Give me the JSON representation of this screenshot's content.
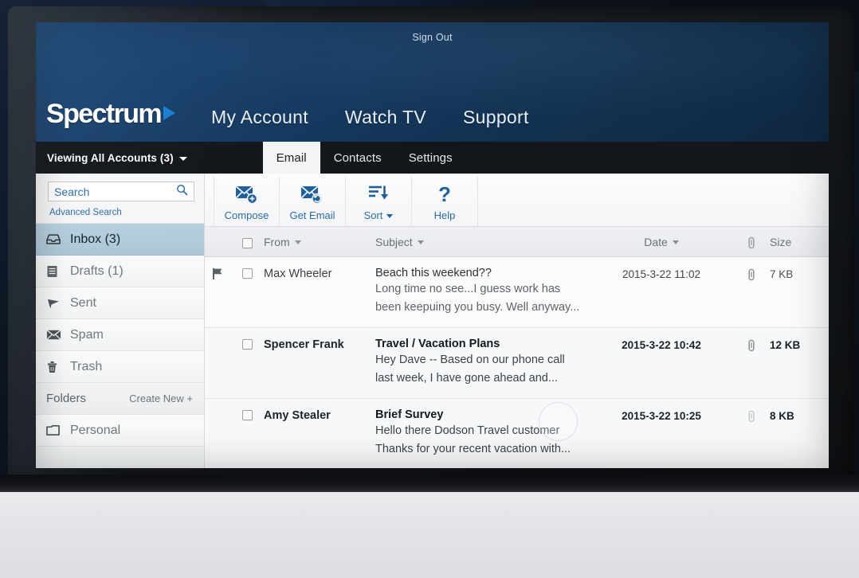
{
  "header": {
    "sign_out": "Sign Out",
    "logo_text": "Spectrum",
    "nav": [
      {
        "label": "My Account"
      },
      {
        "label": "Watch TV"
      },
      {
        "label": "Support"
      }
    ]
  },
  "account_bar": {
    "viewing_label": "Viewing All Accounts (3)",
    "tabs": [
      {
        "label": "Email",
        "active": true
      },
      {
        "label": "Contacts",
        "active": false
      },
      {
        "label": "Settings",
        "active": false
      }
    ]
  },
  "sidebar": {
    "search": {
      "value": "",
      "placeholder": "Search"
    },
    "advanced_search": "Advanced Search",
    "folders": [
      {
        "label": "Inbox (3)",
        "icon": "inbox-icon",
        "selected": true
      },
      {
        "label": "Drafts (1)",
        "icon": "drafts-icon",
        "selected": false
      },
      {
        "label": "Sent",
        "icon": "sent-icon",
        "selected": false
      },
      {
        "label": "Spam",
        "icon": "spam-icon",
        "selected": false
      },
      {
        "label": "Trash",
        "icon": "trash-icon",
        "selected": false
      }
    ],
    "folders_section": {
      "title": "Folders",
      "create_new": "Create New +"
    },
    "custom_folders": [
      {
        "label": "Personal",
        "icon": "folder-icon"
      }
    ]
  },
  "toolbar": {
    "buttons": [
      {
        "label": "Compose",
        "icon": "compose-mail-icon",
        "has_caret": false
      },
      {
        "label": "Get Email",
        "icon": "refresh-mail-icon",
        "has_caret": false
      },
      {
        "label": "Sort",
        "icon": "sort-descending-icon",
        "has_caret": true
      },
      {
        "label": "Help",
        "icon": "question-mark-icon",
        "has_caret": false
      }
    ]
  },
  "mail_list": {
    "columns": {
      "from": "From",
      "subject": "Subject",
      "date": "Date",
      "size": "Size",
      "attachment": "paperclip-icon"
    },
    "rows": [
      {
        "flagged": true,
        "unread": false,
        "from": "Max Wheeler",
        "subject": "Beach this weekend??",
        "preview_line1": "Long time no see...I guess work has",
        "preview_line2": "been keepuing you busy. Well anyway...",
        "date": "2015-3-22 11:02",
        "has_attachment": true,
        "size": "7 KB"
      },
      {
        "flagged": false,
        "unread": true,
        "from": "Spencer Frank",
        "subject": "Travel / Vacation Plans",
        "preview_line1": "Hey Dave -- Based on our phone call",
        "preview_line2": "last week, I have gone ahead and...",
        "date": "2015-3-22 10:42",
        "has_attachment": true,
        "size": "12 KB"
      },
      {
        "flagged": false,
        "unread": true,
        "from": "Amy Stealer",
        "subject": "Brief Survey",
        "preview_line1": "Hello there Dodson Travel customer",
        "preview_line2": "Thanks for your recent vacation with...",
        "date": "2015-3-22 10:25",
        "has_attachment": true,
        "size": "8 KB"
      }
    ]
  },
  "colors": {
    "brand_blue": "#1c7fd0",
    "nav_dark": "#13161b",
    "link_blue": "#2d6ca8",
    "selected_row": "#b7cfdd"
  }
}
